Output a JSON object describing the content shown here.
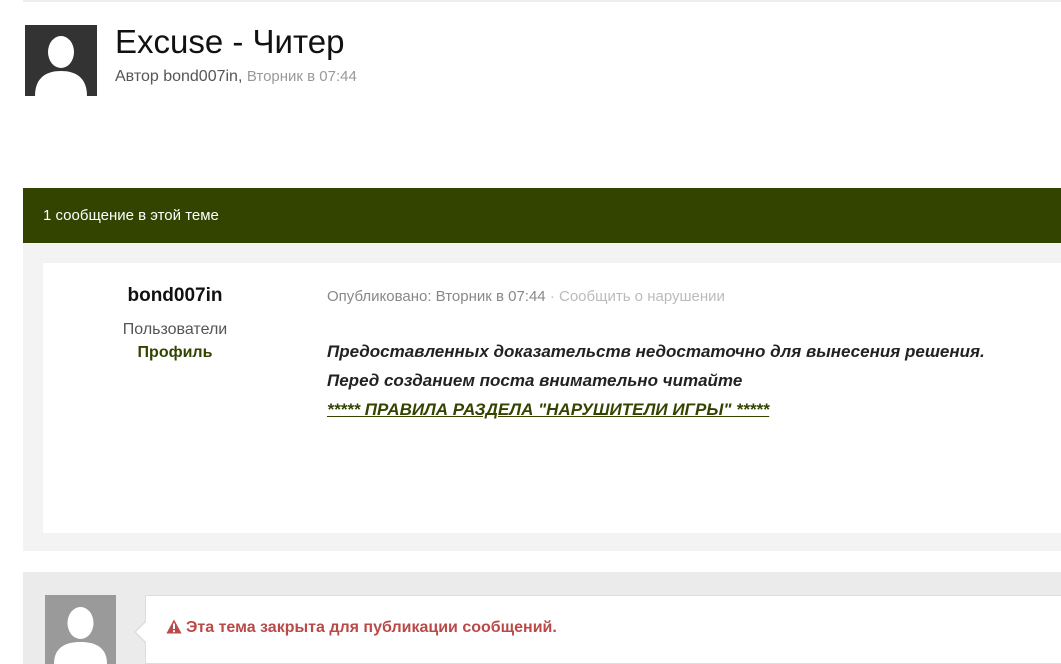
{
  "topic": {
    "title": "Excuse - Читер",
    "author_prefix": "Автор bond007in,",
    "time": "Вторник в 07:44",
    "avatar_icon": "default-user-icon"
  },
  "count_bar": {
    "label": "1 сообщение в этой теме",
    "color": "#334400"
  },
  "post": {
    "author": {
      "name": "bond007in",
      "group": "Пользователи",
      "profile_label": "Профиль"
    },
    "meta": {
      "published": "Опубликовано: Вторник в 07:44",
      "separator": "·",
      "report_label": "Сообщить о нарушении"
    },
    "lines": [
      "Предоставленных доказательств недостаточно для вынесения решения.",
      "Перед созданием поста внимательно читайте"
    ],
    "link_text": "***** ПРАВИЛА РАЗДЕЛА \"НАРУШИТЕЛИ ИГРЫ\" *****"
  },
  "reply": {
    "avatar_icon": "default-user-icon",
    "warning_icon": "warning-triangle-icon",
    "notice": "Эта тема закрыта для публикации сообщений.",
    "notice_color": "#b94a48"
  }
}
